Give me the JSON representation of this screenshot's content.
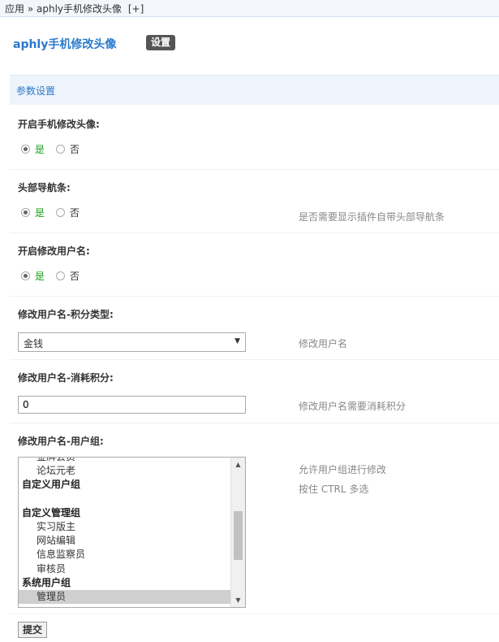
{
  "breadcrumb": {
    "root": "应用",
    "separator": "»",
    "current": "aphly手机修改头像",
    "add": "[+]"
  },
  "header": {
    "title": "aphly手机修改头像",
    "settings_label": "设置"
  },
  "section": {
    "title": "参数设置"
  },
  "fields": [
    {
      "label": "开启手机修改头像:",
      "type": "radio",
      "options": [
        "是",
        "否"
      ],
      "selected": "是",
      "comment": ""
    },
    {
      "label": "头部导航条:",
      "type": "radio",
      "options": [
        "是",
        "否"
      ],
      "selected": "是",
      "comment": "是否需要显示插件自带头部导航条"
    },
    {
      "label": "开启修改用户名:",
      "type": "radio",
      "options": [
        "是",
        "否"
      ],
      "selected": "是",
      "comment": ""
    },
    {
      "label": "修改用户名-积分类型:",
      "type": "select",
      "value": "金钱",
      "comment": "修改用户名"
    },
    {
      "label": "修改用户名-消耗积分:",
      "type": "text",
      "value": "0",
      "comment": "修改用户名需要消耗积分"
    },
    {
      "label": "修改用户名-用户组:",
      "type": "multiselect",
      "comment": "允许用户组进行修改",
      "comment2": "按住 CTRL 多选"
    }
  ],
  "usergroups": [
    {
      "label": "金牌会员",
      "group": false
    },
    {
      "label": "论坛元老",
      "group": false
    },
    {
      "label": "自定义用户组",
      "group": true
    },
    {
      "label": "",
      "group": false
    },
    {
      "label": "自定义管理组",
      "group": true
    },
    {
      "label": "实习版主",
      "group": false
    },
    {
      "label": "网站编辑",
      "group": false
    },
    {
      "label": "信息监察员",
      "group": false
    },
    {
      "label": "审核员",
      "group": false
    },
    {
      "label": "系统用户组",
      "group": true
    },
    {
      "label": "管理员",
      "group": false,
      "selected": true
    }
  ],
  "submit_label": "提交"
}
